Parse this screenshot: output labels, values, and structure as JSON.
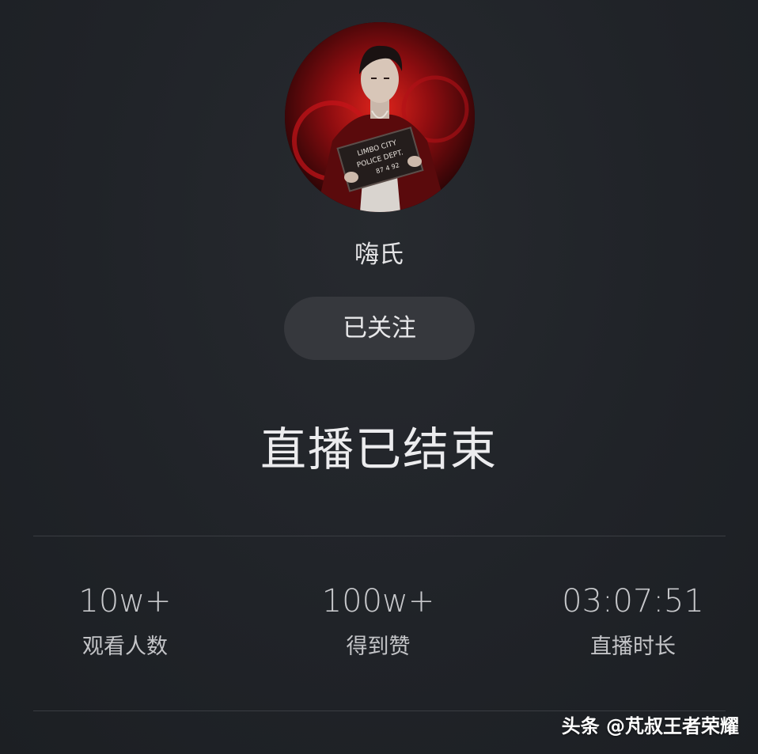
{
  "streamer": {
    "name": "嗨氏",
    "avatar_sign_lines": [
      "LIMBO CITY",
      "POLICE DEPT.",
      "87 4 92"
    ]
  },
  "follow_button": {
    "label": "已关注"
  },
  "status": {
    "title": "直播已结束"
  },
  "stats": [
    {
      "value": "10w+",
      "label": "观看人数"
    },
    {
      "value": "100w+",
      "label": "得到赞"
    },
    {
      "value": "03:07:51",
      "label": "直播时长"
    }
  ],
  "watermark": {
    "text": "头条 @芃叔王者荣耀"
  },
  "colors": {
    "background": "#1f2226",
    "button": "#36383d",
    "divider": "#3a3d42",
    "avatar_red": "#b01218"
  }
}
